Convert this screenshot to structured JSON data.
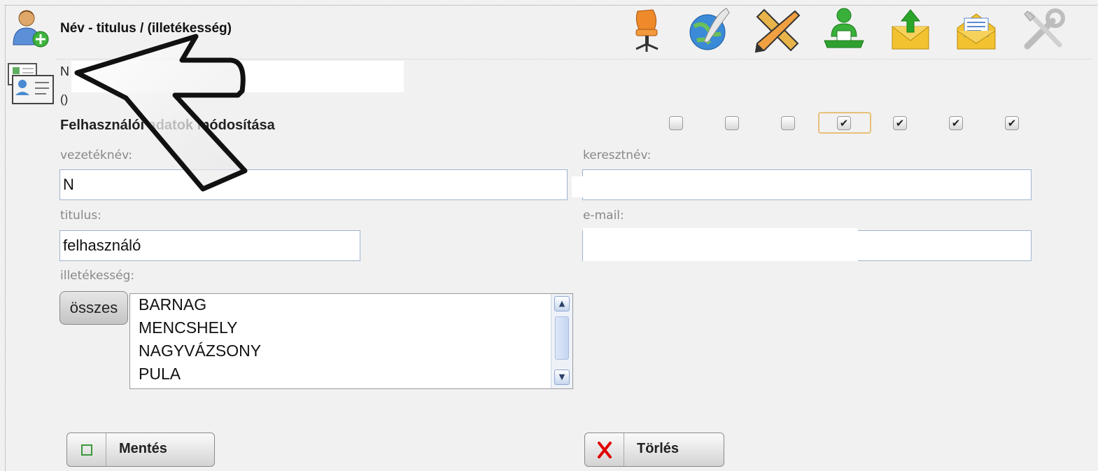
{
  "header": {
    "title": "Név - titulus / (illetékesség)",
    "toolbar_icons": [
      "office-chair-icon",
      "globe-quill-icon",
      "pencil-ruler-icon",
      "user-desk-icon",
      "mail-upload-icon",
      "mail-open-icon",
      "tools-icon"
    ]
  },
  "user": {
    "name_initial": "N",
    "paren": "()"
  },
  "form": {
    "section_title": "Felhasználói adatok módosítása",
    "permission_checkboxes": [
      false,
      false,
      false,
      true,
      true,
      true,
      true
    ],
    "last_name": {
      "label": "vezetéknév:",
      "value": "N"
    },
    "first_name": {
      "label": "keresztnév:",
      "value": ""
    },
    "title": {
      "label": "titulus:",
      "value": "felhasználó"
    },
    "email": {
      "label": "e-mail:",
      "value": ""
    },
    "jurisdiction": {
      "label": "illetékesség:",
      "all_button": "összes",
      "options": [
        "BARNAG",
        "MENCSHELY",
        "NAGYVÁZSONY",
        "PULA"
      ]
    }
  },
  "actions": {
    "save_label": "Mentés",
    "delete_label": "Törlés"
  },
  "colors": {
    "background": "#f1f1f1",
    "field_border": "#9fb4d0",
    "focus_outline": "#e8c07a",
    "delete_icon": "#e00000",
    "save_icon": "#3a9a3a"
  }
}
